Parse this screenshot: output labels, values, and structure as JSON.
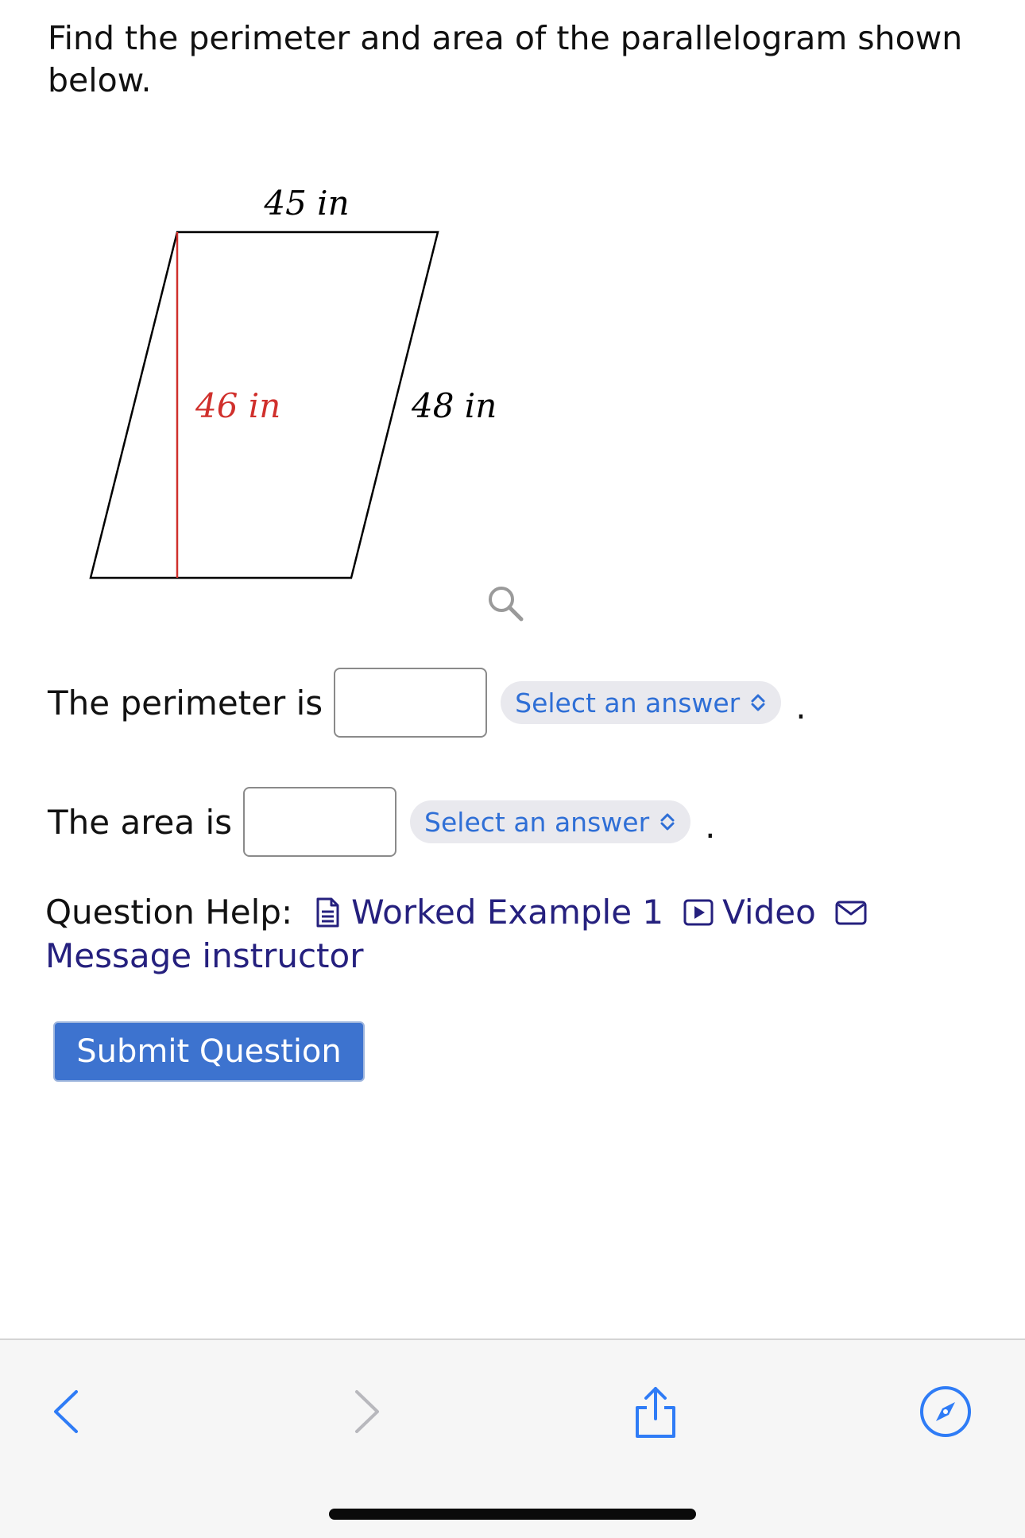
{
  "question": {
    "prompt": "Find the perimeter and area of the parallelogram shown below."
  },
  "figure": {
    "top_label": "45 in",
    "height_label": "46 in",
    "side_label": "48 in",
    "height_color": "#d0302c",
    "icons": {
      "zoom": "magnifier-icon"
    }
  },
  "answers": {
    "perimeter_label": "The perimeter is",
    "perimeter_value": "",
    "perimeter_select": "Select an answer",
    "area_label": "The area is",
    "area_value": "",
    "area_select": "Select an answer",
    "period": "."
  },
  "help": {
    "label": "Question Help:",
    "worked_example": "Worked Example 1",
    "video": "Video",
    "message": "Message instructor",
    "icons": [
      "document-icon",
      "video-play-icon",
      "envelope-icon"
    ]
  },
  "submit": {
    "label": "Submit Question",
    "color": "#3d73cf"
  },
  "toolbar": {
    "icons": [
      "back-chevron-icon",
      "forward-chevron-icon",
      "share-icon",
      "compass-icon"
    ],
    "accent": "#2f7cf6"
  }
}
